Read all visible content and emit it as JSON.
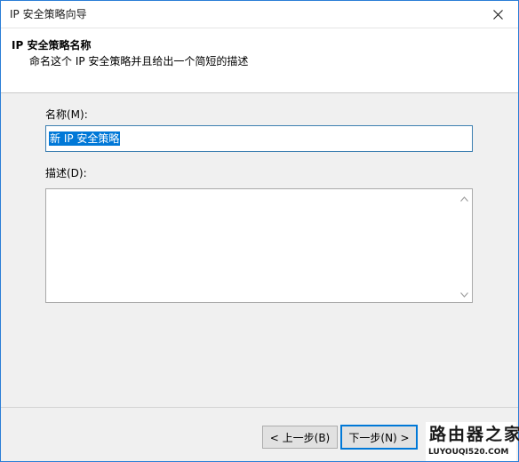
{
  "window": {
    "title": "IP 安全策略向导"
  },
  "header": {
    "title": "IP 安全策略名称",
    "subtitle": "命名这个 IP 安全策略并且给出一个简短的描述"
  },
  "form": {
    "name_label": "名称(M):",
    "name_value": "新 IP 安全策略",
    "description_label": "描述(D):",
    "description_value": ""
  },
  "buttons": {
    "back": "< 上一步(B)",
    "next": "下一步(N) >"
  },
  "watermark": {
    "main": "路由器之家",
    "sub": "LUYOUQI520.COM"
  },
  "colors": {
    "accent": "#0078d7",
    "window_border": "#2b7ed6"
  }
}
